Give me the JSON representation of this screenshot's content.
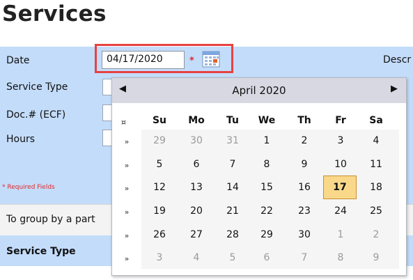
{
  "page": {
    "title": "Services"
  },
  "form": {
    "date_label": "Date",
    "date_value": "04/17/2020",
    "required_star": "*",
    "service_type_label": "Service Type",
    "doc_label": "Doc.# (ECF)",
    "hours_label": "Hours",
    "description_label": "Descr",
    "required_note": "* Required Fields"
  },
  "grid": {
    "group_text": "To group by a part",
    "column_header": "Service Type"
  },
  "datepicker": {
    "month_title": "April 2020",
    "prev_symbol": "◀",
    "next_symbol": "▶",
    "week_header_symbol": "¤",
    "week_arrow": "»",
    "weekdays": [
      "Su",
      "Mo",
      "Tu",
      "We",
      "Th",
      "Fr",
      "Sa"
    ],
    "weeks": [
      [
        "29",
        "30",
        "31",
        "1",
        "2",
        "3",
        "4"
      ],
      [
        "5",
        "6",
        "7",
        "8",
        "9",
        "10",
        "11"
      ],
      [
        "12",
        "13",
        "14",
        "15",
        "16",
        "17",
        "18"
      ],
      [
        "19",
        "20",
        "21",
        "22",
        "23",
        "24",
        "25"
      ],
      [
        "26",
        "27",
        "28",
        "29",
        "30",
        "1",
        "2"
      ],
      [
        "3",
        "4",
        "5",
        "6",
        "7",
        "8",
        "9"
      ]
    ],
    "selected_day": "17",
    "highlight_color": "#e84141",
    "selected_bg": "#fad88a"
  }
}
